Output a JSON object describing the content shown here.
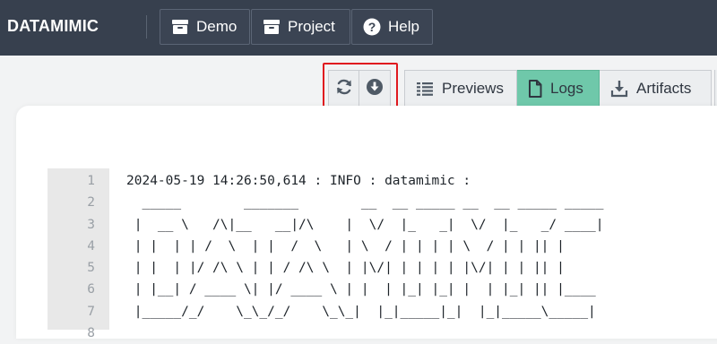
{
  "app": {
    "brand": "DATAMIMIC"
  },
  "nav": {
    "items": [
      {
        "label": "Demo",
        "icon": "archive-box-icon"
      },
      {
        "label": "Project",
        "icon": "archive-box-icon"
      },
      {
        "label": "Help",
        "icon": "question-circle-icon"
      }
    ]
  },
  "toolbar": {
    "actions": [
      {
        "name": "refresh",
        "icon": "refresh-icon"
      },
      {
        "name": "download",
        "icon": "download-circle-icon"
      }
    ],
    "highlight_color": "#e0191f"
  },
  "tabs": [
    {
      "label": "Previews",
      "icon": "list-icon",
      "active": false
    },
    {
      "label": "Logs",
      "icon": "file-icon",
      "active": true
    },
    {
      "label": "Artifacts",
      "icon": "download-tray-icon",
      "active": false
    }
  ],
  "colors": {
    "topbar": "#37404e",
    "active_tab": "#6fc8aa",
    "page_bg": "#f2f3f4"
  },
  "log": {
    "lines": [
      {
        "n": "1",
        "text": "2024-05-19 14:26:50,614 : INFO : datamimic :"
      },
      {
        "n": "2",
        "text": "  _____        _______        __  __ _____ __  __ _____ _____"
      },
      {
        "n": "3",
        "text": " |  __ \\   /\\|__   __|/\\    |  \\/  |_   _|  \\/  |_   _/ ____|"
      },
      {
        "n": "4",
        "text": " | |  | | /  \\  | |  /  \\   | \\  / | | | | \\  / | | || |"
      },
      {
        "n": "5",
        "text": " | |  | |/ /\\ \\ | | / /\\ \\  | |\\/| | | | | |\\/| | | || |"
      },
      {
        "n": "6",
        "text": " | |__| / ____ \\| |/ ____ \\ | |  | |_| |_| |  | |_| || |____"
      },
      {
        "n": "7",
        "text": " |_____/_/    \\_\\_/_/    \\_\\_|  |_|_____|_|  |_|_____\\_____|"
      },
      {
        "n": "8",
        "text": ""
      }
    ]
  }
}
